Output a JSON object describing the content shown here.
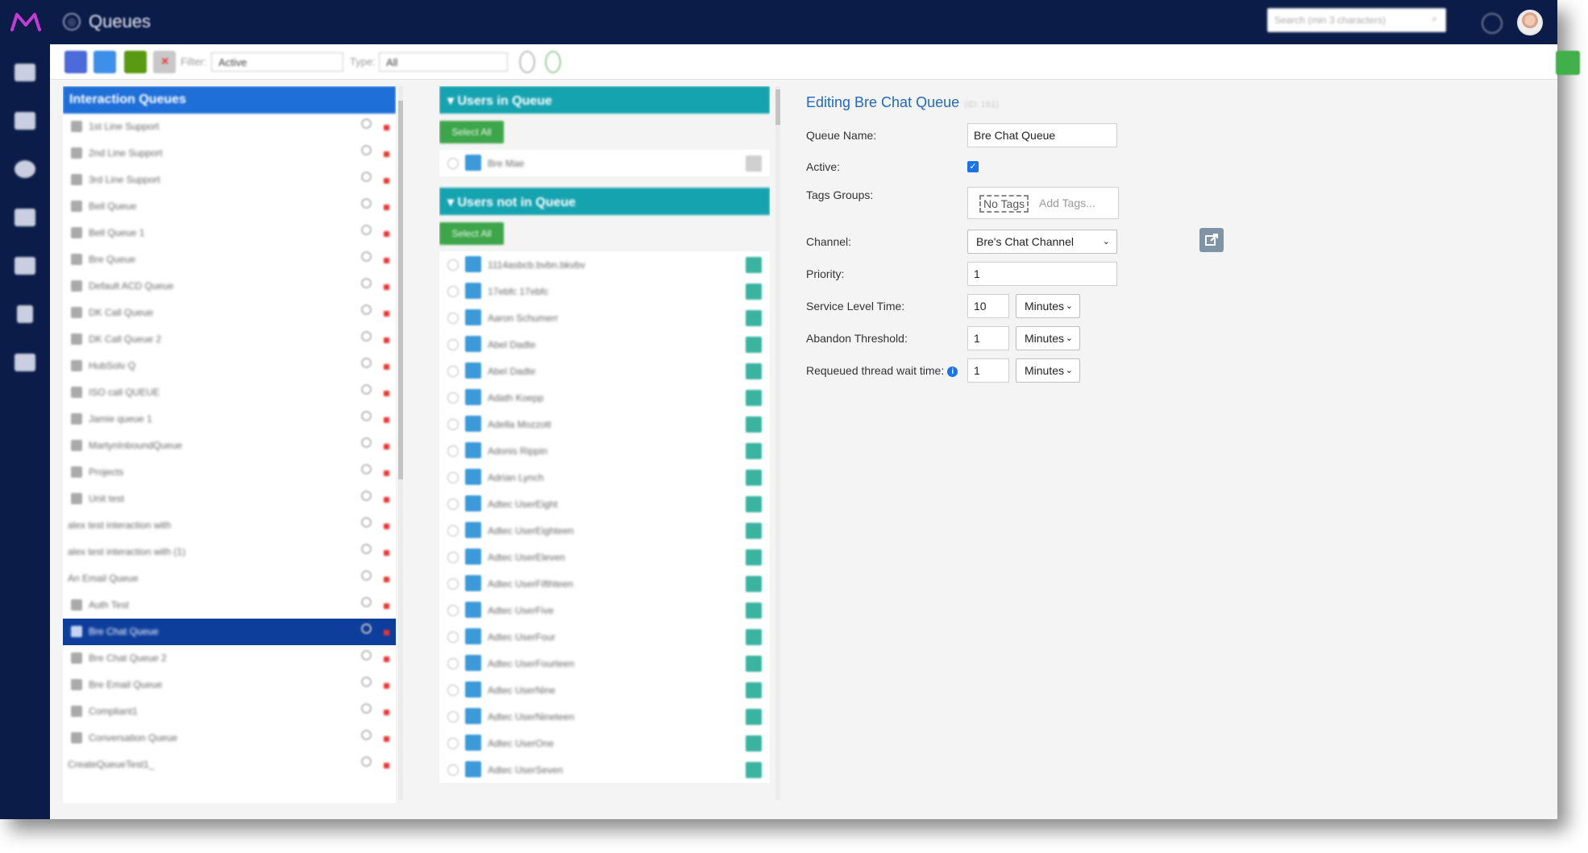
{
  "header": {
    "title": "Queues",
    "search_placeholder": "Search (min 3 characters)"
  },
  "toolbar": {
    "filter_label": "Filter:",
    "filter_value": "Active",
    "type_label": "Type:",
    "type_value": "All"
  },
  "queues_panel": {
    "title": "Interaction Queues",
    "items": [
      {
        "label": "1st Line Support",
        "icon": "phone-icon"
      },
      {
        "label": "2nd Line Support",
        "icon": "phone-icon"
      },
      {
        "label": "3rd Line Support",
        "icon": "phone-icon"
      },
      {
        "label": "Bell Queue",
        "icon": "phone-icon"
      },
      {
        "label": "Bell Queue 1",
        "icon": "phone-icon"
      },
      {
        "label": "Bre Queue",
        "icon": "phone-icon"
      },
      {
        "label": "Default ACD Queue",
        "icon": "phone-icon"
      },
      {
        "label": "DK Call Queue",
        "icon": "phone-icon"
      },
      {
        "label": "DK Call Queue 2",
        "icon": "phone-icon"
      },
      {
        "label": "HubSolv Q",
        "icon": "phone-icon"
      },
      {
        "label": "ISO call QUEUE",
        "icon": "phone-icon"
      },
      {
        "label": "Jamie queue 1",
        "icon": "phone-icon"
      },
      {
        "label": "MartynInboundQueue",
        "icon": "phone-icon"
      },
      {
        "label": "Projects",
        "icon": "phone-icon"
      },
      {
        "label": "Unit test",
        "icon": "phone-icon"
      },
      {
        "label": "alex test interaction with",
        "icon": ""
      },
      {
        "label": "alex test interaction with (1)",
        "icon": ""
      },
      {
        "label": "An Email Queue",
        "icon": ""
      },
      {
        "label": "Auth Test",
        "icon": "email-icon"
      },
      {
        "label": "Bre Chat Queue",
        "icon": "chat-icon",
        "selected": true
      },
      {
        "label": "Bre Chat Queue 2",
        "icon": "chat-icon"
      },
      {
        "label": "Bre Email Queue",
        "icon": "email-icon"
      },
      {
        "label": "Compliant1",
        "icon": "chat-icon"
      },
      {
        "label": "Conversation Queue",
        "icon": "chat-icon"
      },
      {
        "label": "CreateQueueTest1_",
        "icon": ""
      }
    ]
  },
  "users_panel": {
    "in_queue_title": "Users in Queue",
    "not_in_queue_title": "Users not in Queue",
    "select_all_label": "Select All",
    "in_queue": [
      "Bre Mae"
    ],
    "not_in_queue": [
      "1114asbcb.bvbn.bkvbv",
      "17ebfc 17ebfc",
      "Aaron Schumerr",
      "Abel Dadte",
      "Abel Dadte",
      "Adath Koepp",
      "Adella Mozzott",
      "Adonis Rippin",
      "Adrian Lynch",
      "Adtec UserEight",
      "Adtec UserEighteen",
      "Adtec UserEleven",
      "Adtec UserFifthteen",
      "Adtec UserFive",
      "Adtec UserFour",
      "Adtec UserFourteen",
      "Adtec UserNine",
      "Adtec UserNineteen",
      "Adtec UserOne",
      "Adtec UserSeven"
    ]
  },
  "editor": {
    "title": "Editing Bre Chat Queue",
    "title_id": "(ID: 161)",
    "fields": {
      "queue_name_label": "Queue Name:",
      "queue_name_value": "Bre Chat Queue",
      "active_label": "Active:",
      "active_checked": true,
      "tags_label": "Tags Groups:",
      "no_tags_chip": "No Tags",
      "add_tags_placeholder": "Add Tags...",
      "channel_label": "Channel:",
      "channel_value": "Bre's Chat Channel",
      "priority_label": "Priority:",
      "priority_value": "1",
      "slt_label": "Service Level Time:",
      "slt_value": "10",
      "slt_unit": "Minutes",
      "abandon_label": "Abandon Threshold:",
      "abandon_value": "1",
      "abandon_unit": "Minutes",
      "requeue_label": "Requeued thread wait time:",
      "requeue_value": "1",
      "requeue_unit": "Minutes"
    }
  },
  "colors": {
    "nav_bg": "#0c1c48",
    "queues_header": "#1f6fd8",
    "users_header": "#16a3b0",
    "selected_row": "#0e3e9c",
    "link_blue": "#2267c4",
    "select_all_green": "#3da54a"
  }
}
